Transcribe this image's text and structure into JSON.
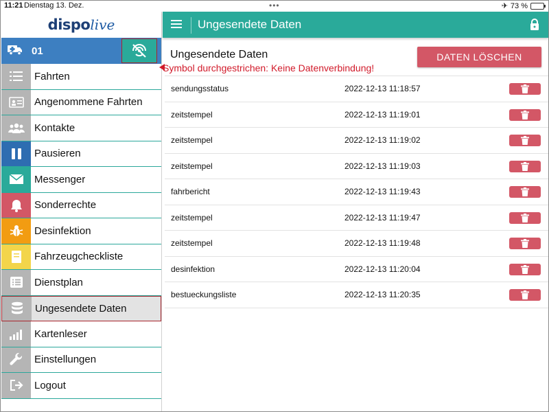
{
  "statusbar": {
    "time": "11:21",
    "date": "Dienstag 13. Dez.",
    "battery": "73 %",
    "battery_level": 0.73
  },
  "logo": {
    "part1": "dispo",
    "part2": "live"
  },
  "vehicle": {
    "number": "01",
    "connection_status": "no-connection"
  },
  "annotation": "Symbol durchgestrichen: Keine Datenverbindung!",
  "menu": [
    {
      "label": "Fahrten",
      "icon": "list-icon",
      "color": "#b5b5b5"
    },
    {
      "label": "Angenommene Fahrten",
      "icon": "id-card-icon",
      "color": "#b5b5b5"
    },
    {
      "label": "Kontakte",
      "icon": "users-icon",
      "color": "#b5b5b5"
    },
    {
      "label": "Pausieren",
      "icon": "pause-icon",
      "color": "#2e6db1"
    },
    {
      "label": "Messenger",
      "icon": "envelope-icon",
      "color": "#2aaa9a"
    },
    {
      "label": "Sonderrechte",
      "icon": "bell-icon",
      "color": "#d35766"
    },
    {
      "label": "Desinfektion",
      "icon": "bug-icon",
      "color": "#f29c12"
    },
    {
      "label": "Fahrzeugcheckliste",
      "icon": "book-icon",
      "color": "#f3d54a"
    },
    {
      "label": "Dienstplan",
      "icon": "list-box-icon",
      "color": "#b5b5b5"
    },
    {
      "label": "Ungesendete Daten",
      "icon": "database-icon",
      "color": "#b5b5b5",
      "active": true
    },
    {
      "label": "Kartenleser",
      "icon": "signal-icon",
      "color": "#b5b5b5"
    },
    {
      "label": "Einstellungen",
      "icon": "wrench-icon",
      "color": "#b5b5b5"
    },
    {
      "label": "Logout",
      "icon": "logout-icon",
      "color": "#b5b5b5"
    }
  ],
  "topbar": {
    "title": "Ungesendete Daten"
  },
  "main": {
    "heading": "Ungesendete Daten",
    "delete_all_label": "DATEN LÖSCHEN",
    "rows": [
      {
        "name": "sendungsstatus",
        "timestamp": "2022-12-13 11:18:57"
      },
      {
        "name": "zeitstempel",
        "timestamp": "2022-12-13 11:19:01"
      },
      {
        "name": "zeitstempel",
        "timestamp": "2022-12-13 11:19:02"
      },
      {
        "name": "zeitstempel",
        "timestamp": "2022-12-13 11:19:03"
      },
      {
        "name": "fahrbericht",
        "timestamp": "2022-12-13 11:19:43"
      },
      {
        "name": "zeitstempel",
        "timestamp": "2022-12-13 11:19:47"
      },
      {
        "name": "zeitstempel",
        "timestamp": "2022-12-13 11:19:48"
      },
      {
        "name": "desinfektion",
        "timestamp": "2022-12-13 11:20:04"
      },
      {
        "name": "bestueckungsliste",
        "timestamp": "2022-12-13 11:20:35"
      }
    ]
  },
  "colors": {
    "primary": "#2aaa9a",
    "vehicle_bar": "#3d7fc1",
    "danger": "#d35766",
    "annotation": "#d11a2a"
  }
}
